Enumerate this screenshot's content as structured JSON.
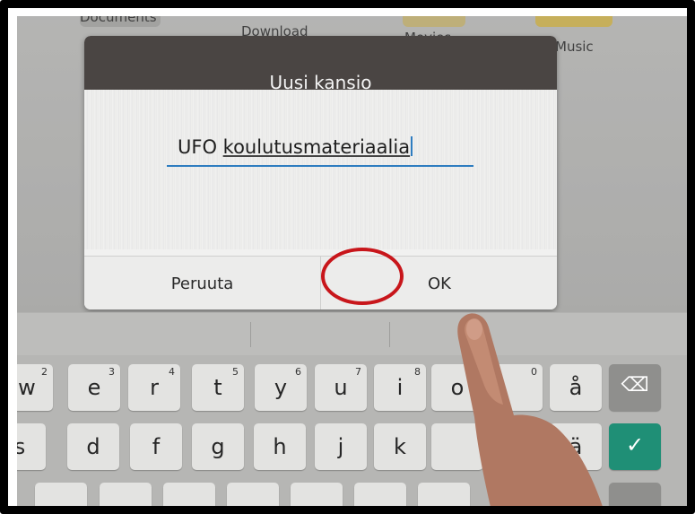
{
  "folders": [
    "Documents",
    "Download",
    "Movies",
    "Music"
  ],
  "dialog": {
    "title": "Uusi kansio",
    "field_value_prefix": "UFO ",
    "field_value_spell": "koulutusmateriaalia",
    "cancel_label": "Peruuta",
    "ok_label": "OK"
  },
  "keyboard": {
    "row1": [
      {
        "char": "w",
        "sup": "2"
      },
      {
        "char": "e",
        "sup": "3"
      },
      {
        "char": "r",
        "sup": "4"
      },
      {
        "char": "t",
        "sup": "5"
      },
      {
        "char": "y",
        "sup": "6"
      },
      {
        "char": "u",
        "sup": "7"
      },
      {
        "char": "i",
        "sup": "8"
      },
      {
        "char": "o",
        "sup": ""
      },
      {
        "char": "",
        "sup": "0"
      },
      {
        "char": "å",
        "sup": ""
      }
    ],
    "row2": [
      "s",
      "d",
      "f",
      "g",
      "h",
      "j",
      "k",
      "",
      "",
      "ä"
    ],
    "backspace_icon": "backspace-icon",
    "enter_icon": "checkmark-icon",
    "enter_color": "#1f8f76"
  },
  "colors": {
    "dialog_header": "#4a4543",
    "field_underline": "#2e7dc0",
    "highlight_ring": "#c8161b"
  }
}
